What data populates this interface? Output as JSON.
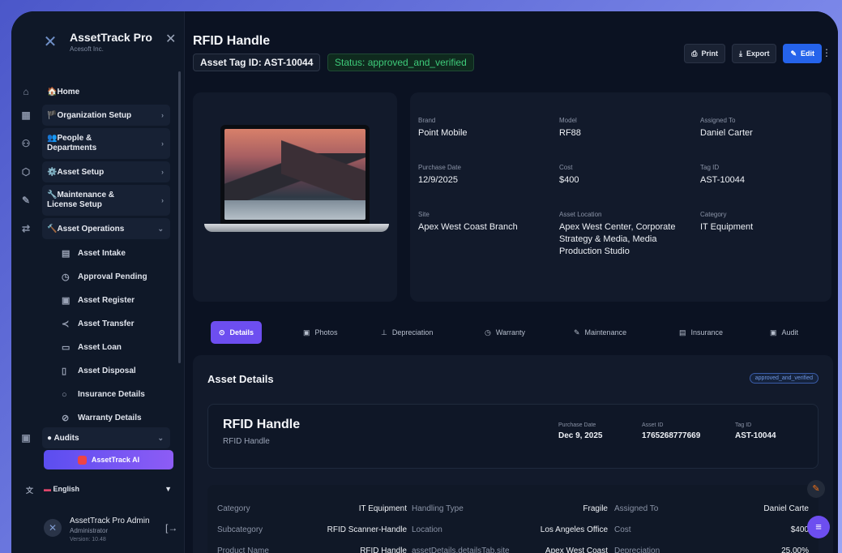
{
  "sidebar": {
    "brand_title": "AssetTrack Pro",
    "brand_sub": "Acesoft Inc.",
    "items": [
      {
        "label": "🏠Home",
        "chev": ""
      },
      {
        "label": "🏴Organization Setup",
        "chev": "›"
      },
      {
        "label": "👥People & Departments",
        "chev": "›"
      },
      {
        "label": "⚙️Asset Setup",
        "chev": "›"
      },
      {
        "label": "🔧Maintenance & License Setup",
        "chev": "›"
      },
      {
        "label": "🔨Asset Operations",
        "chev": "⌄"
      }
    ],
    "sub_items": [
      "Asset Intake",
      "Approval Pending",
      "Asset Register",
      "Asset Transfer",
      "Asset Loan",
      "Asset Disposal",
      "Insurance Details",
      "Warranty Details"
    ],
    "audits_label": "● Audits",
    "ai_button": "AssetTrack AI",
    "language": "English",
    "user_name": "AssetTrack Pro Admin",
    "user_role": "Administrator",
    "version": "Version: 10.48"
  },
  "header": {
    "title": "RFID Handle",
    "asset_tag": "Asset Tag ID: AST-10044",
    "status": "Status: approved_and_verified",
    "print": "Print",
    "export": "Export",
    "edit": "Edit"
  },
  "info": {
    "brand_label": "Brand",
    "brand": "Point Mobile",
    "model_label": "Model",
    "model": "RF88",
    "assigned_label": "Assigned To",
    "assigned": "Daniel Carter",
    "purchase_label": "Purchase Date",
    "purchase": "12/9/2025",
    "cost_label": "Cost",
    "cost": "$400",
    "tag_label": "Tag ID",
    "tag": "AST-10044",
    "site_label": "Site",
    "site": "Apex West Coast Branch",
    "location_label": "Asset Location",
    "location": "Apex West Center, Corporate Strategy & Media, Media Production Studio",
    "category_label": "Category",
    "category": "IT Equipment"
  },
  "tabs": [
    "Details",
    "Photos",
    "Depreciation",
    "Warranty",
    "Maintenance",
    "Insurance",
    "Audit"
  ],
  "details": {
    "title": "Asset Details",
    "badge": "approved_and_verified",
    "name": "RFID Handle",
    "sub": "RFID Handle",
    "purchase_label": "Purchase Date",
    "purchase": "Dec 9, 2025",
    "asset_id_label": "Asset ID",
    "asset_id": "1765268777669",
    "tag_label": "Tag ID",
    "tag": "AST-10044",
    "rows": [
      [
        "Category",
        "IT Equipment",
        "Handling Type",
        "Fragile",
        "Assigned To",
        "Daniel Carte"
      ],
      [
        "Subcategory",
        "RFID Scanner-Handle",
        "Location",
        "Los Angeles Office",
        "Cost",
        "$400"
      ],
      [
        "Product Name",
        "RFID Handle",
        "assetDetails.detailsTab.site",
        "Apex West Coast Branch",
        "Depreciation",
        "25.00%"
      ]
    ]
  }
}
